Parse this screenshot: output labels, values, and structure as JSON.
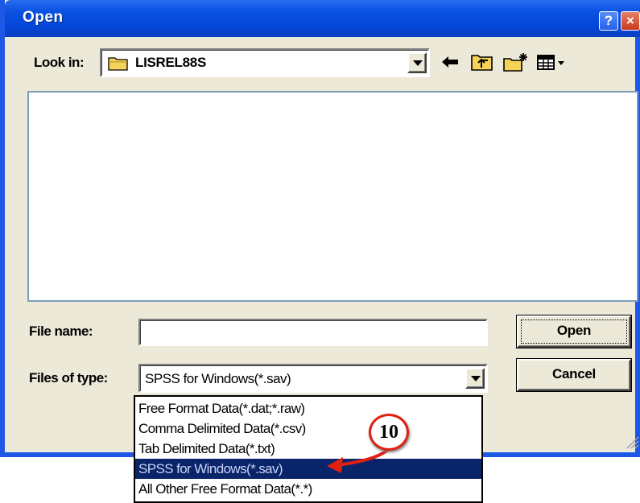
{
  "window": {
    "title": "Open",
    "help_label": "?",
    "close_label": "×"
  },
  "look_in": {
    "label": "Look in:",
    "value": "LISREL88S"
  },
  "toolbar": {
    "icons": [
      "back-arrow-icon",
      "up-one-level-icon",
      "new-folder-icon",
      "view-menu-icon"
    ]
  },
  "file_name": {
    "label": "File name:",
    "value": ""
  },
  "files_of_type": {
    "label": "Files of type:",
    "value": "SPSS for Windows(*.sav)",
    "options": [
      "Free Format Data(*.dat;*.raw)",
      "Comma Delimited Data(*.csv)",
      "Tab Delimited Data(*.txt)",
      "SPSS for Windows(*.sav)",
      "All Other Free Format Data(*.*)"
    ]
  },
  "buttons": {
    "open": "Open",
    "cancel": "Cancel"
  },
  "annotation": {
    "label": "10"
  },
  "colors": {
    "titlebar": "#0b53e2",
    "dialog_bg": "#ece9d8",
    "selection": "#0a246a",
    "annotation": "#e02010"
  }
}
